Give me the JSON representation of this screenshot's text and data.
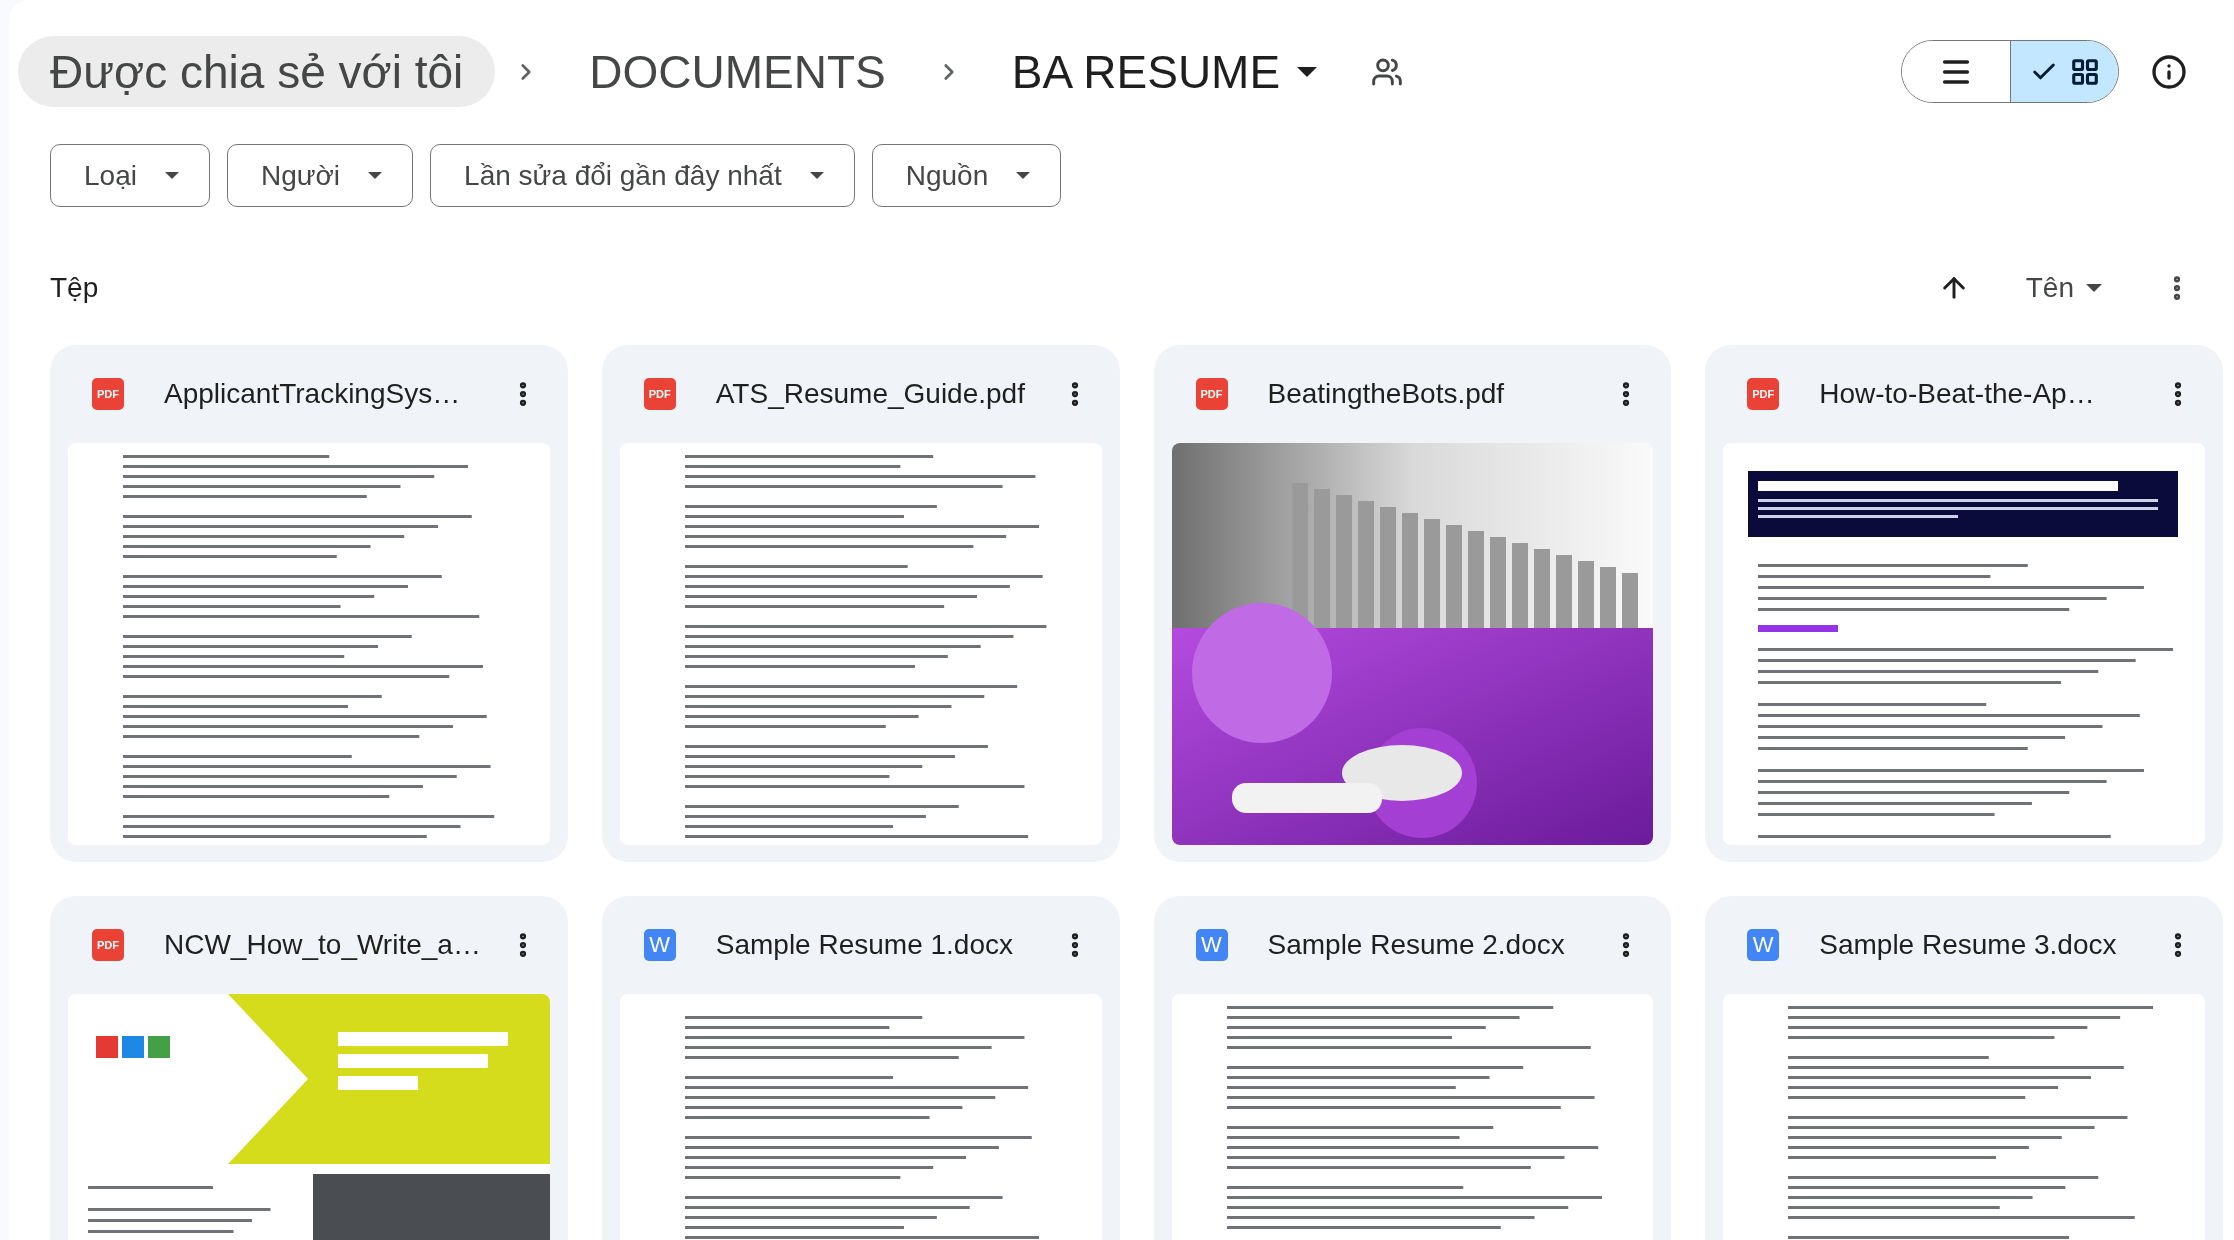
{
  "breadcrumb": [
    {
      "label": "Được chia sẻ với tôi",
      "hovered": true,
      "current": false,
      "shared": false
    },
    {
      "label": "DOCUMENTS",
      "hovered": false,
      "current": false,
      "shared": false
    },
    {
      "label": "BA RESUME",
      "hovered": false,
      "current": true,
      "shared": true
    }
  ],
  "view_toggle": [
    {
      "kind": "list",
      "selected": false
    },
    {
      "kind": "grid",
      "selected": true
    }
  ],
  "filters": [
    "Loại",
    "Người",
    "Lần sửa đổi gần đây nhất",
    "Nguồn"
  ],
  "section": {
    "title": "Tệp",
    "sort": {
      "ascending": true,
      "label": "Tên"
    }
  },
  "files": [
    {
      "name": "ApplicantTrackingSys…",
      "kind": "pdf",
      "icon_text": "PDF",
      "thumbnail": {
        "kind": "text-page"
      }
    },
    {
      "name": "ATS_Resume_Guide.pdf",
      "kind": "pdf",
      "icon_text": "PDF",
      "thumbnail": {
        "kind": "text-page"
      }
    },
    {
      "name": "BeatingtheBots.pdf",
      "kind": "pdf",
      "icon_text": "PDF",
      "thumbnail": {
        "kind": "photo-slide"
      }
    },
    {
      "name": "How-to-Beat-the-Ap…",
      "kind": "pdf",
      "icon_text": "PDF",
      "thumbnail": {
        "kind": "headed-page"
      }
    },
    {
      "name": "NCW_How_to_Write_a…",
      "kind": "pdf",
      "icon_text": "PDF",
      "thumbnail": {
        "kind": "banner-page"
      }
    },
    {
      "name": "Sample Resume 1.docx",
      "kind": "word",
      "icon_text": "W",
      "thumbnail": {
        "kind": "text-page"
      }
    },
    {
      "name": "Sample Resume 2.docx",
      "kind": "word",
      "icon_text": "W",
      "thumbnail": {
        "kind": "text-page"
      }
    },
    {
      "name": "Sample Resume 3.docx",
      "kind": "word",
      "icon_text": "W",
      "thumbnail": {
        "kind": "text-page"
      }
    }
  ]
}
